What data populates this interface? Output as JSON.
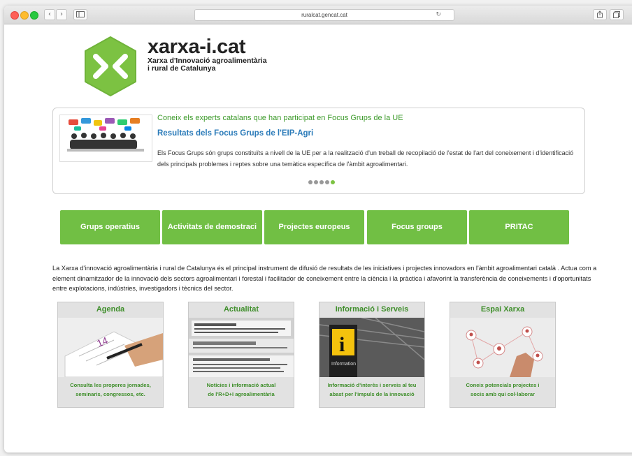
{
  "browser": {
    "url": "ruralcat.gencat.cat",
    "back_glyph": "‹",
    "forward_glyph": "›",
    "reload_glyph": "↻"
  },
  "brand": {
    "name": "xarxa-i.cat",
    "subtitle_line1": "Xarxa d'Innovació agroalimentària",
    "subtitle_line2": "i rural de Catalunya",
    "logo_color": "#7cc242",
    "logo_symbol": "><"
  },
  "slider": {
    "kicker": "Coneix els experts catalans que han participat en Focus Grups de la UE",
    "title": "Resultats dels Focus Grups de l'EIP-Agri",
    "text": "Els Focus Grups són grups constituïts a nivell de la UE per a la realització d'un treball de recopilació de l'estat de l'art del coneixement i d'identificació dels principals problemes i reptes sobre una temàtica específica de l'àmbit agroalimentari.",
    "dots": 5,
    "active_dot": 4
  },
  "nav": {
    "items": [
      {
        "label": "Grups operatius"
      },
      {
        "label": "Activitats de demostraci"
      },
      {
        "label": "Projectes europeus"
      },
      {
        "label": "Focus groups"
      },
      {
        "label": "PRITAC"
      }
    ],
    "color": "#71bf44"
  },
  "intro": "La Xarxa d'innovació agroalimentària i rural de Catalunya és el principal instrument de difusió de resultats de les iniciatives i projectes innovadors en l'àmbit agroalimentari català . Actua com a element dinamitzador de la innovació dels sectors agroalimentari i forestal i facilitador de coneixement entre la ciència i la pràctica i afavorint la transferència de coneixements i d'oportunitats entre explotacions, indústries, investigadors i tècnics del sector.",
  "cards": [
    {
      "title": "Agenda",
      "desc1": "Consulta les properes jornades,",
      "desc2": "seminaris, congressos, etc."
    },
    {
      "title": "Actualitat",
      "desc1": "Notícies i informació actual",
      "desc2": "de l'R+D+I agroalimentària"
    },
    {
      "title": "Informació i Serveis",
      "desc1": "Informació d'interès i serveis al teu",
      "desc2": "abast per l'impuls de la innovació"
    },
    {
      "title": "Espai Xarxa",
      "desc1": "Coneix potencials projectes i",
      "desc2": "socis amb qui col·laborar"
    }
  ],
  "images": {
    "calendar_day": "14",
    "info_sign_letter": "i",
    "info_sign_word": "Information"
  }
}
